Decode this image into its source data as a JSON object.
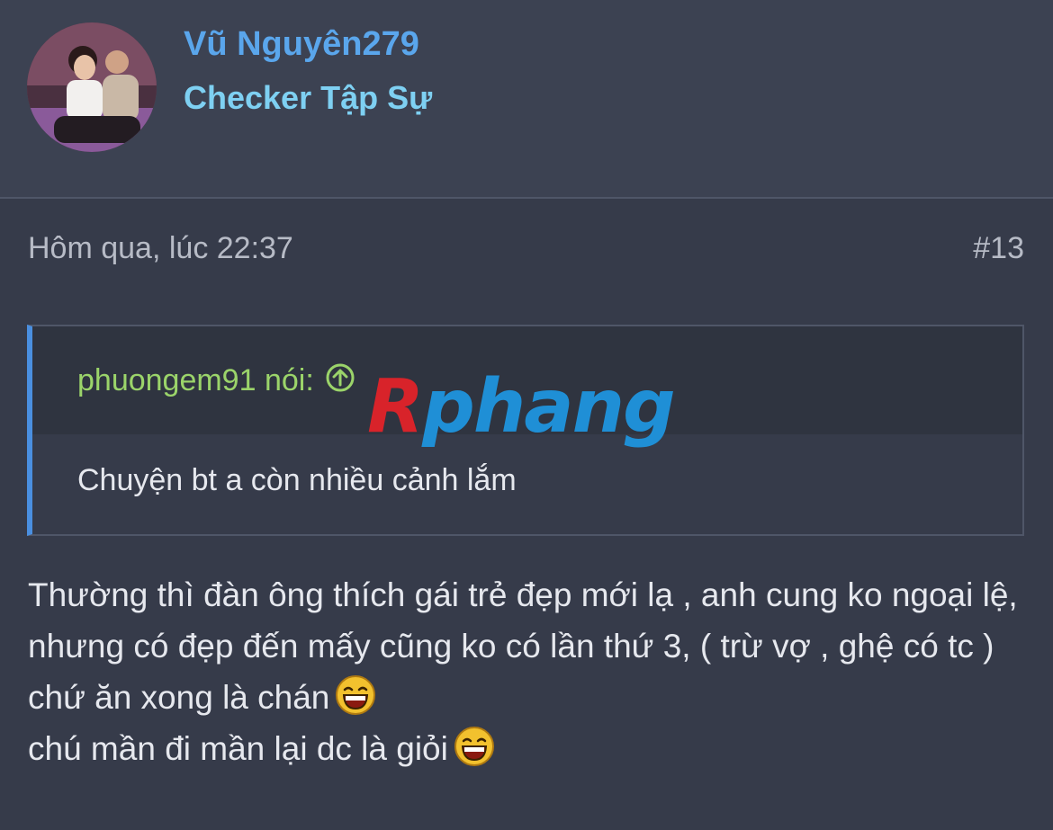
{
  "user": {
    "name": "Vũ Nguyên279",
    "title": "Checker Tập Sự"
  },
  "post": {
    "timestamp": "Hôm qua, lúc 22:37",
    "number": "#13",
    "quote": {
      "author": "phuongem91 nói:",
      "text": "Chuyện bt a còn nhiều cảnh lắm"
    },
    "watermark": {
      "first": "R",
      "rest": "phang"
    },
    "message": {
      "line1": "Thường thì đàn ông thích gái trẻ đẹp mới lạ , anh cung ko ngoại lệ, nhưng có đẹp đến mấy cũng ko có lần thứ 3, ( trừ vợ , ghệ có tc ) chứ ăn xong là chán",
      "line2": "chú mần đi mần lại dc là giỏi"
    }
  },
  "colors": {
    "username": "#5aa6ec",
    "usertitle": "#7ed0f2",
    "quote_author": "#9bd46a",
    "quote_border": "#4a8fe0"
  },
  "icons": [
    "avatar-photo",
    "quote-jump-arrow-icon",
    "laughing-emoji-icon"
  ]
}
